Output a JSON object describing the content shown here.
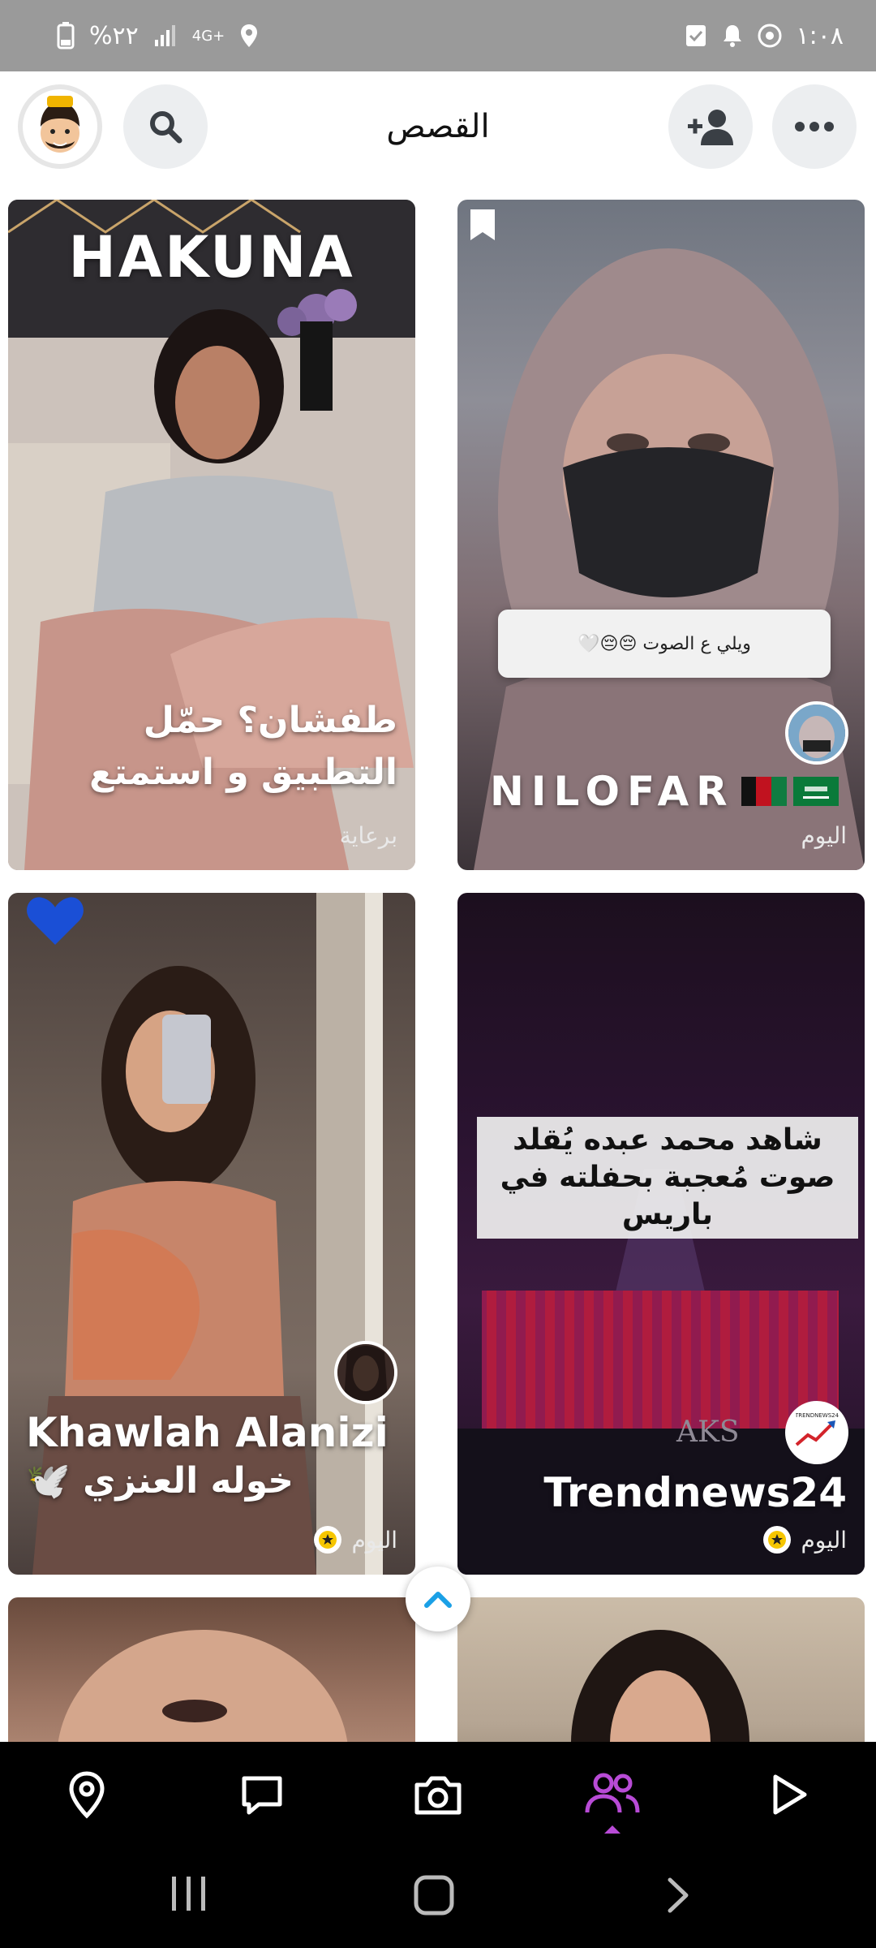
{
  "status_bar": {
    "time": "١:٠٨",
    "battery": "%٢٢",
    "network": "4G+"
  },
  "header": {
    "title": "القصص"
  },
  "cards": [
    {
      "overlay_text": "HAKUNA",
      "title": "طفشان؟ حمّل التطبيق و استمتع",
      "meta": "برعاية"
    },
    {
      "sticker_text": "ويلي ع الصوت 😔😔🤍",
      "title": "NILOFAR",
      "meta": "اليوم"
    },
    {
      "title": "Khawlah Alanizi",
      "subtitle": "خوله العنزي 🕊️",
      "meta": "اليوم"
    },
    {
      "overlay_text": "شاهد محمد عبده يُقلد صوت مُعجبة بحفلته في باريس",
      "title": "Trendnews24",
      "meta": "اليوم",
      "stage_text": "AKS",
      "avatar_label": "TRENDNEWS24"
    }
  ],
  "colors": {
    "accent": "#b84bd6",
    "scroll_up": "#1aa0e6",
    "star": "#f6c600"
  }
}
